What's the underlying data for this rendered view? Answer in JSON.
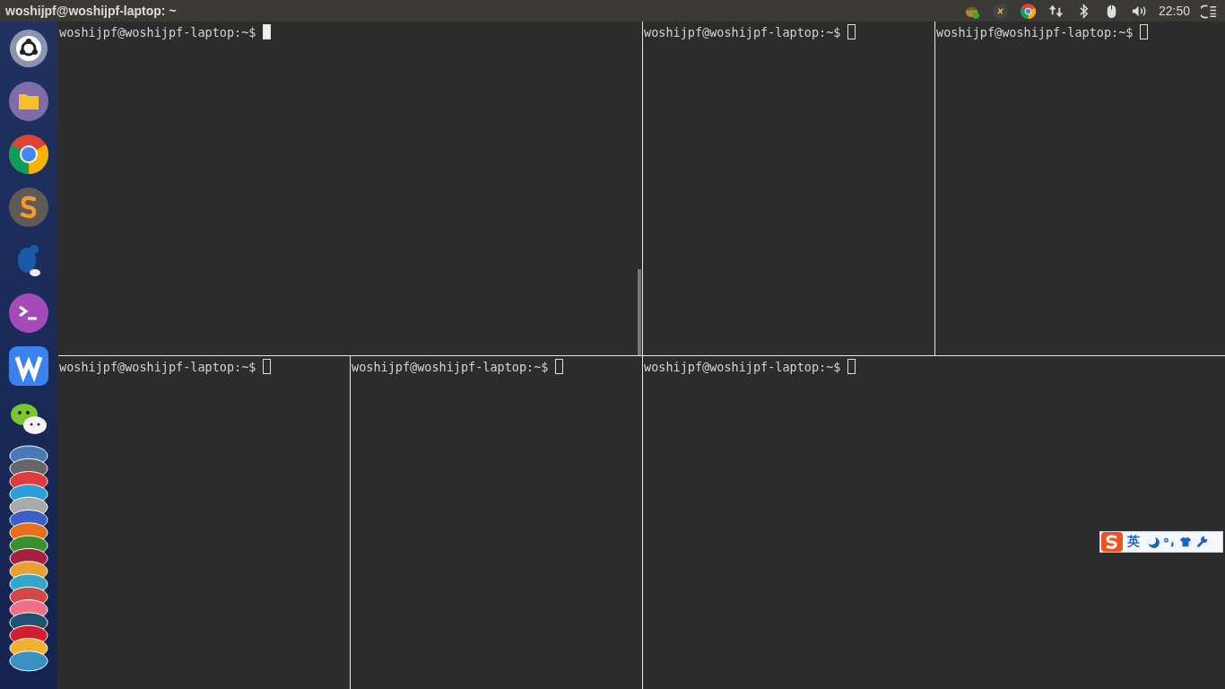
{
  "top_bar": {
    "title": "woshijpf@woshijpf-laptop: ~",
    "clock": "22:50"
  },
  "panes": [
    {
      "prompt": "woshijpf@woshijpf-laptop:~$",
      "focused": true
    },
    {
      "prompt": "woshijpf@woshijpf-laptop:~$",
      "focused": false
    },
    {
      "prompt": "woshijpf@woshijpf-laptop:~$",
      "focused": false
    },
    {
      "prompt": "woshijpf@woshijpf-laptop:~$",
      "focused": false
    },
    {
      "prompt": "woshijpf@woshijpf-laptop:~$",
      "focused": false
    },
    {
      "prompt": "woshijpf@woshijpf-laptop:~$",
      "focused": false
    }
  ],
  "ime_bar": {
    "mode": "英"
  }
}
